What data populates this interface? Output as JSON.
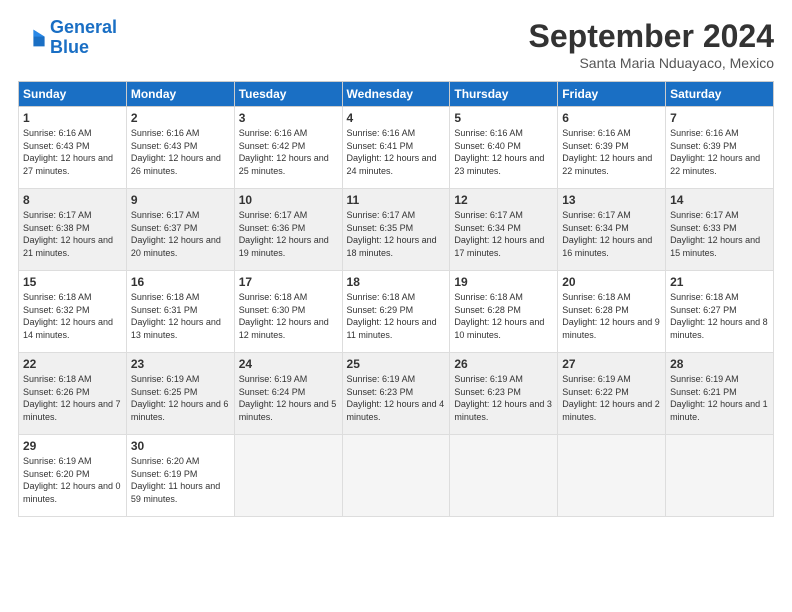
{
  "logo": {
    "line1": "General",
    "line2": "Blue"
  },
  "title": "September 2024",
  "subtitle": "Santa Maria Nduayaco, Mexico",
  "headers": [
    "Sunday",
    "Monday",
    "Tuesday",
    "Wednesday",
    "Thursday",
    "Friday",
    "Saturday"
  ],
  "weeks": [
    [
      {
        "day": "1",
        "sunrise": "6:16 AM",
        "sunset": "6:43 PM",
        "daylight": "12 hours and 27 minutes."
      },
      {
        "day": "2",
        "sunrise": "6:16 AM",
        "sunset": "6:43 PM",
        "daylight": "12 hours and 26 minutes."
      },
      {
        "day": "3",
        "sunrise": "6:16 AM",
        "sunset": "6:42 PM",
        "daylight": "12 hours and 25 minutes."
      },
      {
        "day": "4",
        "sunrise": "6:16 AM",
        "sunset": "6:41 PM",
        "daylight": "12 hours and 24 minutes."
      },
      {
        "day": "5",
        "sunrise": "6:16 AM",
        "sunset": "6:40 PM",
        "daylight": "12 hours and 23 minutes."
      },
      {
        "day": "6",
        "sunrise": "6:16 AM",
        "sunset": "6:39 PM",
        "daylight": "12 hours and 22 minutes."
      },
      {
        "day": "7",
        "sunrise": "6:16 AM",
        "sunset": "6:39 PM",
        "daylight": "12 hours and 22 minutes."
      }
    ],
    [
      {
        "day": "8",
        "sunrise": "6:17 AM",
        "sunset": "6:38 PM",
        "daylight": "12 hours and 21 minutes."
      },
      {
        "day": "9",
        "sunrise": "6:17 AM",
        "sunset": "6:37 PM",
        "daylight": "12 hours and 20 minutes."
      },
      {
        "day": "10",
        "sunrise": "6:17 AM",
        "sunset": "6:36 PM",
        "daylight": "12 hours and 19 minutes."
      },
      {
        "day": "11",
        "sunrise": "6:17 AM",
        "sunset": "6:35 PM",
        "daylight": "12 hours and 18 minutes."
      },
      {
        "day": "12",
        "sunrise": "6:17 AM",
        "sunset": "6:34 PM",
        "daylight": "12 hours and 17 minutes."
      },
      {
        "day": "13",
        "sunrise": "6:17 AM",
        "sunset": "6:34 PM",
        "daylight": "12 hours and 16 minutes."
      },
      {
        "day": "14",
        "sunrise": "6:17 AM",
        "sunset": "6:33 PM",
        "daylight": "12 hours and 15 minutes."
      }
    ],
    [
      {
        "day": "15",
        "sunrise": "6:18 AM",
        "sunset": "6:32 PM",
        "daylight": "12 hours and 14 minutes."
      },
      {
        "day": "16",
        "sunrise": "6:18 AM",
        "sunset": "6:31 PM",
        "daylight": "12 hours and 13 minutes."
      },
      {
        "day": "17",
        "sunrise": "6:18 AM",
        "sunset": "6:30 PM",
        "daylight": "12 hours and 12 minutes."
      },
      {
        "day": "18",
        "sunrise": "6:18 AM",
        "sunset": "6:29 PM",
        "daylight": "12 hours and 11 minutes."
      },
      {
        "day": "19",
        "sunrise": "6:18 AM",
        "sunset": "6:28 PM",
        "daylight": "12 hours and 10 minutes."
      },
      {
        "day": "20",
        "sunrise": "6:18 AM",
        "sunset": "6:28 PM",
        "daylight": "12 hours and 9 minutes."
      },
      {
        "day": "21",
        "sunrise": "6:18 AM",
        "sunset": "6:27 PM",
        "daylight": "12 hours and 8 minutes."
      }
    ],
    [
      {
        "day": "22",
        "sunrise": "6:18 AM",
        "sunset": "6:26 PM",
        "daylight": "12 hours and 7 minutes."
      },
      {
        "day": "23",
        "sunrise": "6:19 AM",
        "sunset": "6:25 PM",
        "daylight": "12 hours and 6 minutes."
      },
      {
        "day": "24",
        "sunrise": "6:19 AM",
        "sunset": "6:24 PM",
        "daylight": "12 hours and 5 minutes."
      },
      {
        "day": "25",
        "sunrise": "6:19 AM",
        "sunset": "6:23 PM",
        "daylight": "12 hours and 4 minutes."
      },
      {
        "day": "26",
        "sunrise": "6:19 AM",
        "sunset": "6:23 PM",
        "daylight": "12 hours and 3 minutes."
      },
      {
        "day": "27",
        "sunrise": "6:19 AM",
        "sunset": "6:22 PM",
        "daylight": "12 hours and 2 minutes."
      },
      {
        "day": "28",
        "sunrise": "6:19 AM",
        "sunset": "6:21 PM",
        "daylight": "12 hours and 1 minute."
      }
    ],
    [
      {
        "day": "29",
        "sunrise": "6:19 AM",
        "sunset": "6:20 PM",
        "daylight": "12 hours and 0 minutes."
      },
      {
        "day": "30",
        "sunrise": "6:20 AM",
        "sunset": "6:19 PM",
        "daylight": "11 hours and 59 minutes."
      },
      null,
      null,
      null,
      null,
      null
    ]
  ]
}
